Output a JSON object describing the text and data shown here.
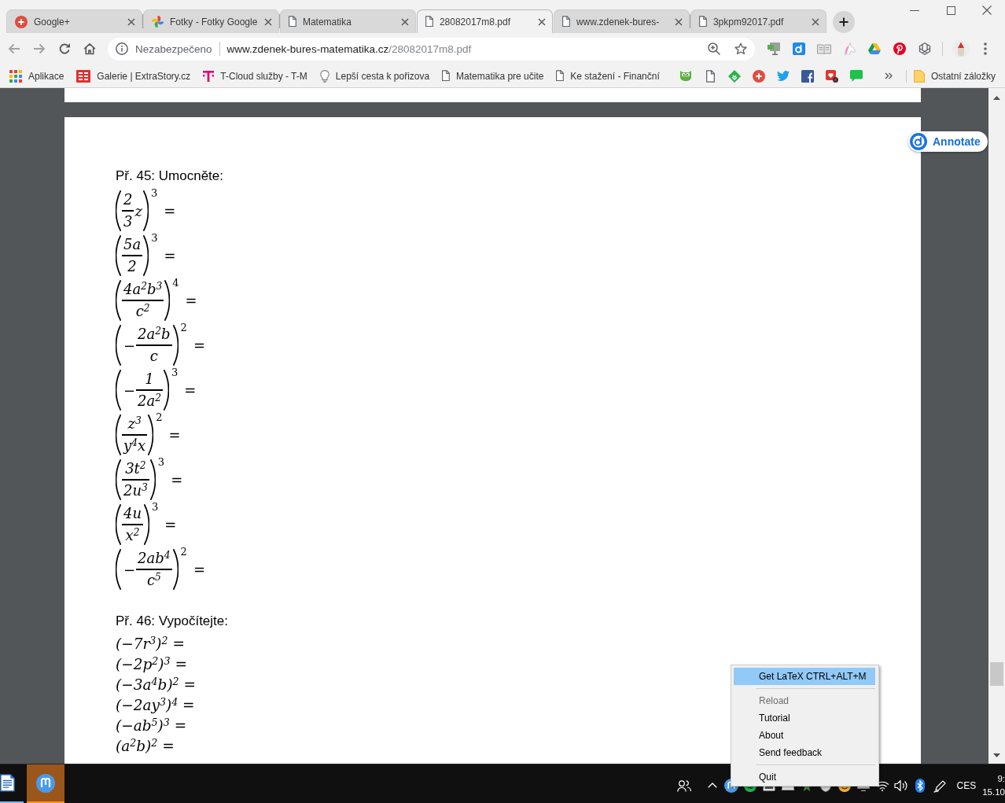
{
  "tabs": [
    {
      "title": "Google+",
      "kind": "social",
      "selected": false
    },
    {
      "title": "Fotky - Fotky Google",
      "kind": "photos",
      "selected": false
    },
    {
      "title": "Matematika",
      "kind": "page",
      "selected": false
    },
    {
      "title": "28082017m8.pdf",
      "kind": "page",
      "selected": true
    },
    {
      "title": "www.zdenek-bures-",
      "kind": "page",
      "selected": false
    },
    {
      "title": "3pkpm92017.pdf",
      "kind": "page",
      "selected": false
    }
  ],
  "address_bar": {
    "security_label": "Nezabezpečeno",
    "url": {
      "host": "www.zdenek-bures-matematika.cz",
      "path": "/28082017m8.pdf"
    }
  },
  "bookmarks": [
    {
      "label": "Aplikace",
      "kind": "apps"
    },
    {
      "label": "Galerie | ExtraStory.cz",
      "kind": "extrastory"
    },
    {
      "label": "T-Cloud služby - T-M",
      "kind": "tcloud"
    },
    {
      "label": "Lepší cesta k pořizova",
      "kind": "bulb"
    },
    {
      "label": "Matematika pre učite",
      "kind": "page"
    },
    {
      "label": "Ke stažení - Finanční",
      "kind": "page"
    },
    {
      "kind": "owl"
    },
    {
      "kind": "page"
    },
    {
      "kind": "feedly"
    },
    {
      "kind": "social"
    },
    {
      "kind": "twitter"
    },
    {
      "kind": "facebook"
    },
    {
      "kind": "gearbadge"
    },
    {
      "kind": "chat"
    }
  ],
  "other_bookmarks": {
    "label": "Ostatní záložky"
  },
  "annotate_button": {
    "label": "Annotate"
  },
  "document": {
    "exercises": [
      {
        "title": "Př. 45: Umocněte:",
        "kind": "fractions",
        "items": [
          {
            "numerator": "2",
            "denominator": "3",
            "after": "z",
            "exponent": "3",
            "equals": "="
          },
          {
            "numerator": "5a",
            "denominator": "2",
            "exponent": "3",
            "equals": "="
          },
          {
            "numerator": "4a$^{2}$b$^{3}$",
            "denominator": "c$^{2}$",
            "exponent": "4",
            "equals": "="
          },
          {
            "minus": "−",
            "numerator": "2a$^{2}$b",
            "denominator": "c",
            "exponent": "2",
            "equals": "="
          },
          {
            "minus": "−",
            "numerator": "1",
            "denominator": "2a$^{2}$",
            "exponent": "3",
            "equals": "="
          },
          {
            "numerator": "z$^{3}$",
            "denominator": "y$^{4}$x",
            "exponent": "2",
            "equals": "="
          },
          {
            "numerator": "3t$^{2}$",
            "denominator": "2u$^{3}$",
            "exponent": "3",
            "equals": "="
          },
          {
            "numerator": "4u",
            "denominator": "x$^{2}$",
            "exponent": "3",
            "equals": "="
          },
          {
            "minus": "−",
            "numerator": "2ab$^{4}$",
            "denominator": "c$^{5}$",
            "exponent": "2",
            "equals": "="
          }
        ]
      },
      {
        "title": "Př. 46: Vypočítejte:",
        "kind": "lines",
        "items": [
          "(−7r$^{3}$)$^{2}$ =",
          "(−2p$^{2}$)$^{3}$ =",
          "(−3a$^{4}$b)$^{2}$ =",
          "(−2ay$^{3}$)$^{4}$ =",
          "(−ab$^{5}$)$^{3}$ =",
          "(a$^{2}$b)$^{2}$ ="
        ]
      }
    ]
  },
  "context_menu": {
    "groups": [
      {
        "items": [
          {
            "label": "Get LaTeX CTRL+ALT+M",
            "selected": true,
            "disabled": false
          }
        ]
      },
      {
        "items": [
          {
            "label": "Reload",
            "selected": false,
            "disabled": true
          },
          {
            "label": "Tutorial",
            "selected": false,
            "disabled": false
          },
          {
            "label": "About",
            "selected": false,
            "disabled": false
          },
          {
            "label": "Send feedback",
            "selected": false,
            "disabled": false
          }
        ]
      },
      {
        "items": [
          {
            "label": "Quit",
            "selected": false,
            "disabled": false
          }
        ]
      }
    ]
  },
  "taskbar": {
    "apps": [
      {
        "kind": "writer",
        "highlighted": false
      },
      {
        "kind": "mathpix",
        "highlighted": true
      }
    ],
    "language": "CES",
    "time": "9:",
    "date": "15.10"
  }
}
